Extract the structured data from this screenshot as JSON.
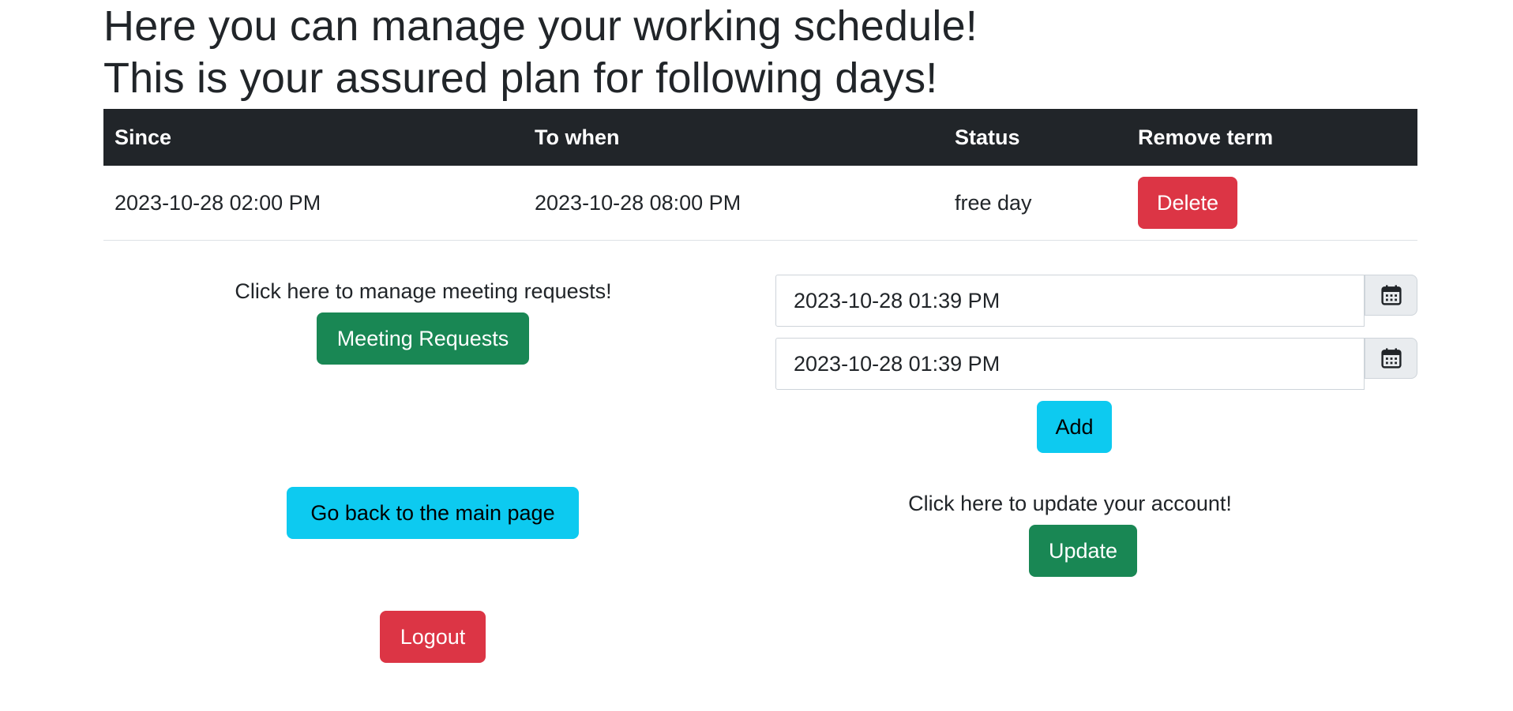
{
  "header": {
    "line1": "Here you can manage your working schedule!",
    "line2": "This is your assured plan for following days!"
  },
  "table": {
    "columns": [
      "Since",
      "To when",
      "Status",
      "Remove term"
    ],
    "rows": [
      {
        "since": "2023-10-28 02:00 PM",
        "to_when": "2023-10-28 08:00 PM",
        "status": "free day",
        "action_label": "Delete"
      }
    ]
  },
  "meetings": {
    "prompt": "Click here to manage meeting requests!",
    "button_label": "Meeting Requests"
  },
  "navigation": {
    "back_label": "Go back to the main page",
    "logout_label": "Logout"
  },
  "add_term": {
    "start_value": "2023-10-28 01:39 PM",
    "end_value": "2023-10-28 01:39 PM",
    "add_label": "Add",
    "calendar_icon": "calendar-icon"
  },
  "account": {
    "prompt": "Click here to update your account!",
    "update_label": "Update"
  },
  "colors": {
    "dark_header": "#212529",
    "danger": "#dc3545",
    "success": "#198754",
    "info": "#0dcaf0"
  }
}
